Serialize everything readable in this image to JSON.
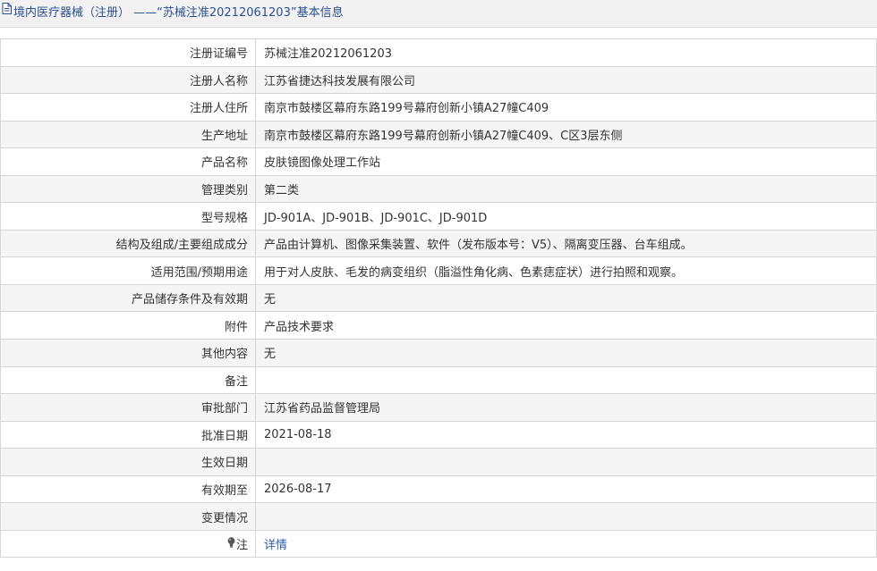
{
  "header": {
    "title": "境内医疗器械（注册） ——“苏械注准20212061203”基本信息"
  },
  "rows": [
    {
      "label": "注册证编号",
      "value": "苏械注准20212061203"
    },
    {
      "label": "注册人名称",
      "value": "江苏省捷达科技发展有限公司"
    },
    {
      "label": "注册人住所",
      "value": "南京市鼓楼区幕府东路199号幕府创新小镇A27幢C409"
    },
    {
      "label": "生产地址",
      "value": "南京市鼓楼区幕府东路199号幕府创新小镇A27幢C409、C区3层东侧"
    },
    {
      "label": "产品名称",
      "value": "皮肤镜图像处理工作站"
    },
    {
      "label": "管理类别",
      "value": "第二类"
    },
    {
      "label": "型号规格",
      "value": "JD-901A、JD-901B、JD-901C、JD-901D"
    },
    {
      "label": "结构及组成/主要组成成分",
      "value": "产品由计算机、图像采集装置、软件（发布版本号：V5）、隔离变压器、台车组成。"
    },
    {
      "label": "适用范围/预期用途",
      "value": "用于对人皮肤、毛发的病变组织（脂溢性角化病、色素痣症状）进行拍照和观察。"
    },
    {
      "label": "产品储存条件及有效期",
      "value": "无"
    },
    {
      "label": "附件",
      "value": "产品技术要求"
    },
    {
      "label": "其他内容",
      "value": "无"
    },
    {
      "label": "备注",
      "value": ""
    },
    {
      "label": "审批部门",
      "value": "江苏省药品监督管理局"
    },
    {
      "label": "批准日期",
      "value": "2021-08-18"
    },
    {
      "label": "生效日期",
      "value": ""
    },
    {
      "label": "有效期至",
      "value": "2026-08-17"
    },
    {
      "label": "变更情况",
      "value": ""
    }
  ],
  "note": {
    "label": "注",
    "link_text": "详情",
    "icon": "lightbulb-icon"
  },
  "colors": {
    "title_text": "#2a4f8f",
    "link": "#2c5dab",
    "border": "#d6d6d6",
    "row_alt": "#f5f5f5"
  }
}
